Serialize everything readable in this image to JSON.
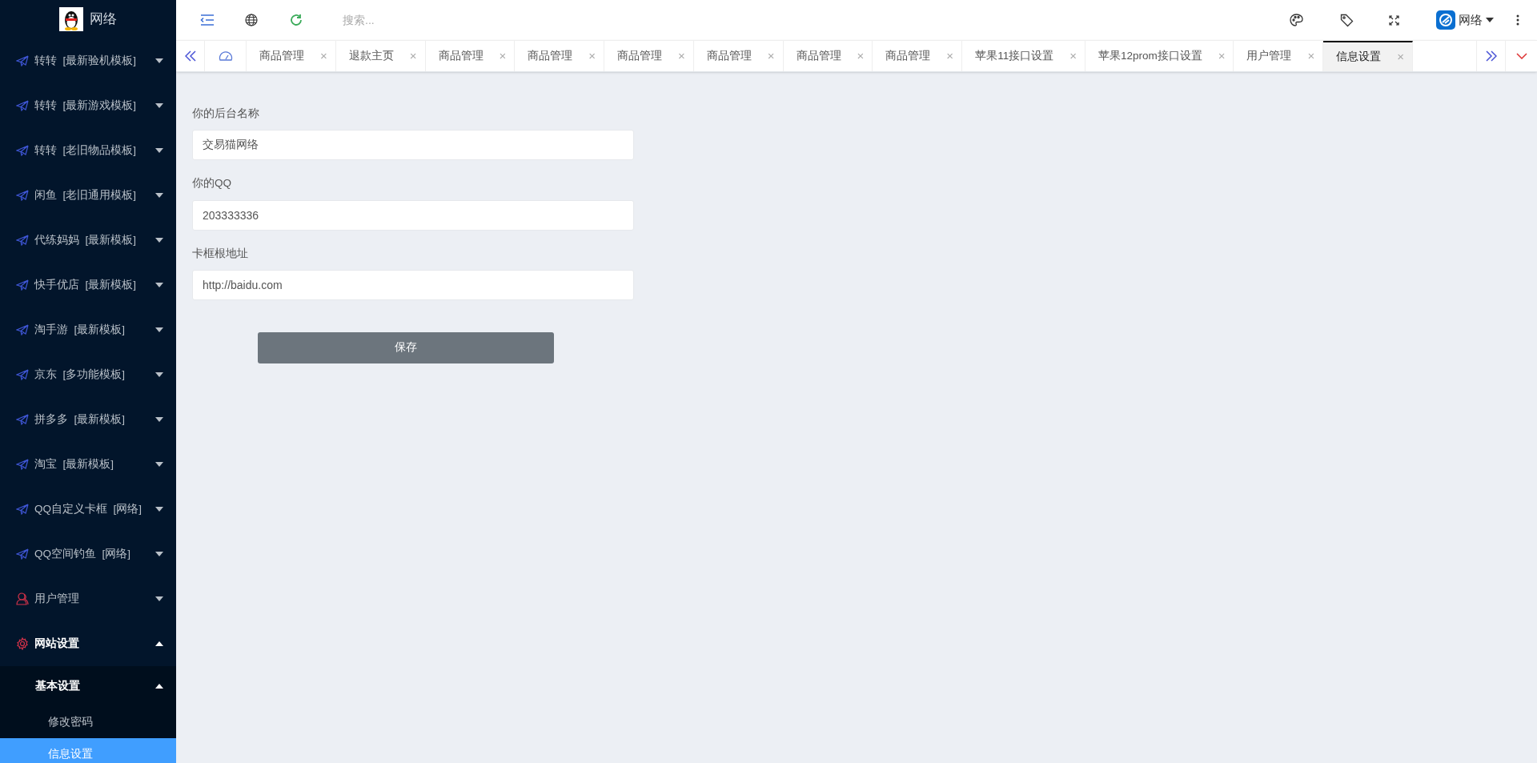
{
  "sidebar": {
    "brand": "网络",
    "items": [
      {
        "kind": "plane",
        "label": "转转  [最新验机模板]",
        "expanded": false
      },
      {
        "kind": "plane",
        "label": "转转  [最新游戏模板]",
        "expanded": false
      },
      {
        "kind": "plane",
        "label": "转转  [老旧物品模板]",
        "expanded": false
      },
      {
        "kind": "plane",
        "label": "闲鱼  [老旧通用模板]",
        "expanded": false
      },
      {
        "kind": "plane",
        "label": "代练妈妈  [最新模板]",
        "expanded": false
      },
      {
        "kind": "plane",
        "label": "快手优店  [最新模板]",
        "expanded": false
      },
      {
        "kind": "plane",
        "label": "淘手游  [最新模板]",
        "expanded": false
      },
      {
        "kind": "plane",
        "label": "京东  [多功能模板]",
        "expanded": false
      },
      {
        "kind": "plane",
        "label": "拼多多  [最新模板]",
        "expanded": false
      },
      {
        "kind": "plane",
        "label": "淘宝  [最新模板]",
        "expanded": false
      },
      {
        "kind": "plane",
        "label": "QQ自定义卡框  [网络]",
        "expanded": false
      },
      {
        "kind": "plane",
        "label": "QQ空间钓鱼  [网络]",
        "expanded": false
      },
      {
        "kind": "user",
        "label": "用户管理",
        "expanded": false
      },
      {
        "kind": "gear",
        "label": "网站设置",
        "expanded": true,
        "children": [
          {
            "label": "基本设置",
            "expanded": true,
            "children": [
              {
                "label": "修改密码",
                "selected": false
              },
              {
                "label": "信息设置",
                "selected": true
              }
            ]
          }
        ]
      }
    ]
  },
  "header": {
    "search": {
      "placeholder": "搜索..."
    },
    "user": "网络"
  },
  "tabs": [
    {
      "label": "商品管理",
      "selected": false
    },
    {
      "label": "退款主页",
      "selected": false
    },
    {
      "label": "商品管理",
      "selected": false
    },
    {
      "label": "商品管理",
      "selected": false
    },
    {
      "label": "商品管理",
      "selected": false
    },
    {
      "label": "商品管理",
      "selected": false
    },
    {
      "label": "商品管理",
      "selected": false
    },
    {
      "label": "商品管理",
      "selected": false
    },
    {
      "label": "苹果11接口设置",
      "selected": false
    },
    {
      "label": "苹果12prom接口设置",
      "selected": false
    },
    {
      "label": "用户管理",
      "selected": false
    },
    {
      "label": "信息设置",
      "selected": true
    }
  ],
  "tab_close": "×",
  "form": {
    "fields": [
      {
        "label": "你的后台名称",
        "value": "交易猫网络"
      },
      {
        "label": "你的QQ",
        "value": "203333336"
      },
      {
        "label": "卡框根地址",
        "value": "http://baidu.com"
      }
    ],
    "button": "保存"
  }
}
